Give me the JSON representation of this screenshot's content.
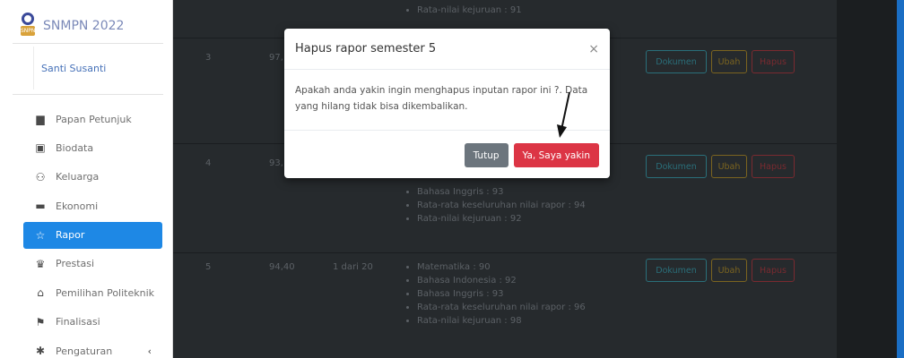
{
  "brand": {
    "title": "SNMPN 2022"
  },
  "user": {
    "name": "Santi Susanti"
  },
  "nav": {
    "items": [
      {
        "label": "Papan Petunjuk",
        "icon": "clipboard-icon"
      },
      {
        "label": "Biodata",
        "icon": "id-card-icon"
      },
      {
        "label": "Keluarga",
        "icon": "users-icon"
      },
      {
        "label": "Ekonomi",
        "icon": "wallet-icon"
      },
      {
        "label": "Rapor",
        "icon": "star-icon"
      },
      {
        "label": "Prestasi",
        "icon": "trophy-icon"
      },
      {
        "label": "Pemilihan Politeknik",
        "icon": "university-icon"
      },
      {
        "label": "Finalisasi",
        "icon": "flag-icon"
      },
      {
        "label": "Pengaturan",
        "icon": "gear-icon"
      }
    ],
    "active": "Rapor"
  },
  "table": {
    "top_partial": {
      "item": "Rata-nilai kejuruan : 91"
    },
    "rows": [
      {
        "no": "3",
        "nilai": "97,",
        "peringkat": ""
      },
      {
        "no": "4",
        "nilai": "93,",
        "peringkat": "",
        "items": [
          "Bahasa Inggris : 93",
          "Rata-rata keseluruhan nilai rapor : 94",
          "Rata-nilai kejuruan : 92"
        ]
      },
      {
        "no": "5",
        "nilai": "94,40",
        "peringkat": "1 dari 20",
        "items": [
          "Matematika : 90",
          "Bahasa Indonesia : 92",
          "Bahasa Inggris : 93",
          "Rata-rata keseluruhan nilai rapor : 96",
          "Rata-nilai kejuruan : 98"
        ]
      }
    ],
    "actions": {
      "dokumen": "Dokumen",
      "ubah": "Ubah",
      "hapus": "Hapus"
    }
  },
  "modal": {
    "title": "Hapus rapor semester 5",
    "close": "×",
    "body": "Apakah anda yakin ingin menghapus inputan rapor ini ?. Data yang hilang tidak bisa dikembalikan.",
    "cancel": "Tutup",
    "confirm": "Ya, Saya yakin"
  },
  "colors": {
    "primary": "#1e88e5",
    "danger": "#dc3545",
    "secondary": "#6c757d"
  }
}
